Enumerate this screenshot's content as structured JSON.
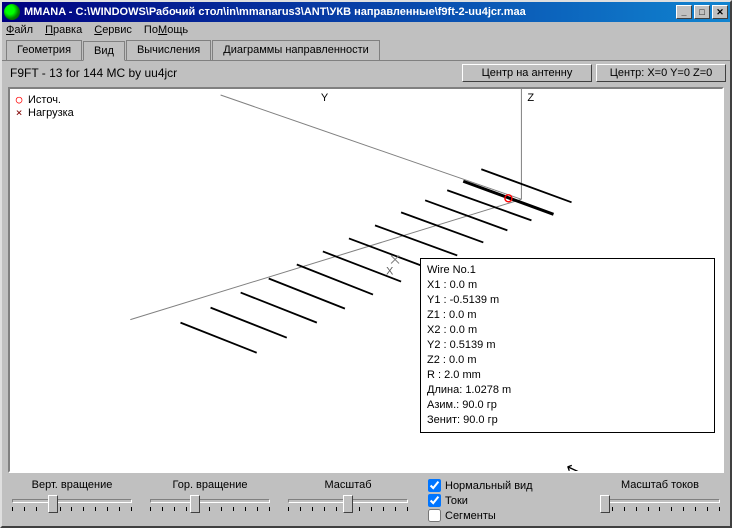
{
  "title": "MMANA - C:\\WINDOWS\\Рабочий стол\\in\\mmanarus3\\ANT\\УКВ направленные\\f9ft-2-uu4jcr.maa",
  "menu": {
    "file": "Файл",
    "edit": "Правка",
    "service": "Сервис",
    "help": "ПоМощь"
  },
  "tabs": {
    "geometry": "Геометрия",
    "view": "Вид",
    "calc": "Вычисления",
    "pattern": "Диаграммы направленности"
  },
  "subtitle": "F9FT - 13 for 144 MC by uu4jcr",
  "buttons": {
    "center_ant": "Центр на антенну",
    "center_xyz": "Центр: X=0 Y=0 Z=0"
  },
  "legend": {
    "source": "Источ.",
    "load": "Нагрузка"
  },
  "axes": {
    "y": "Y",
    "z": "Z"
  },
  "info_lines": [
    "Wire No.1",
    "X1   : 0.0 m",
    "Y1   : -0.5139 m",
    "Z1   : 0.0 m",
    "X2   : 0.0 m",
    "Y2   : 0.5139 m",
    "Z2   : 0.0 m",
    "R    : 2.0 mm",
    "Длина: 1.0278 m",
    "Азим.: 90.0 гр",
    "Зенит: 90.0 гр"
  ],
  "sliders": {
    "vert": "Верт. вращение",
    "horiz": "Гор. вращение",
    "scale": "Масштаб",
    "current_scale": "Масштаб токов"
  },
  "checks": {
    "normal": "Нормальный вид",
    "currents": "Токи",
    "segments": "Сегменты"
  },
  "check_state": {
    "normal": true,
    "currents": true,
    "segments": false
  }
}
